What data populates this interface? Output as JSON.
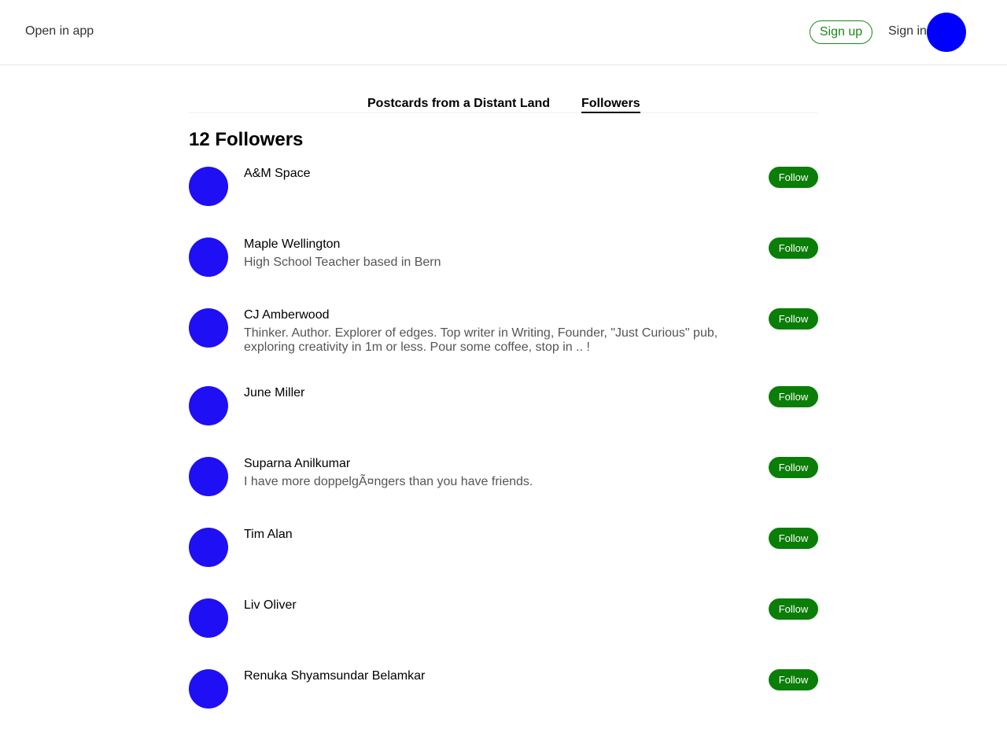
{
  "header": {
    "open_in_app": "Open in app",
    "sign_up": "Sign up",
    "sign_in": "Sign in"
  },
  "tabs": [
    {
      "label": "Postcards from a Distant Land"
    },
    {
      "label": "Followers"
    }
  ],
  "followers_count": "12 Followers",
  "followers": [
    {
      "name": "A&M Space",
      "bio": "",
      "follow": "Follow"
    },
    {
      "name": "Maple Wellington",
      "bio": "High School Teacher based in Bern",
      "follow": "Follow"
    },
    {
      "name": "CJ Amberwood",
      "bio": "Thinker. Author. Explorer of edges. Top writer in Writing, Founder, \"Just Curious\" pub, exploring creativity in 1m or less. Pour some coffee, stop in .. !",
      "follow": "Follow"
    },
    {
      "name": "June Miller",
      "bio": "",
      "follow": "Follow"
    },
    {
      "name": "Suparna Anilkumar",
      "bio": "I have more doppelgÃ¤ngers than you have friends.",
      "follow": "Follow"
    },
    {
      "name": "Tim Alan",
      "bio": "",
      "follow": "Follow"
    },
    {
      "name": "Liv Oliver",
      "bio": "",
      "follow": "Follow"
    },
    {
      "name": "Renuka Shyamsundar Belamkar",
      "bio": "",
      "follow": "Follow"
    }
  ],
  "colors": {
    "accent_green": "#1a8917",
    "avatar_blue": "#1e0ff5"
  }
}
